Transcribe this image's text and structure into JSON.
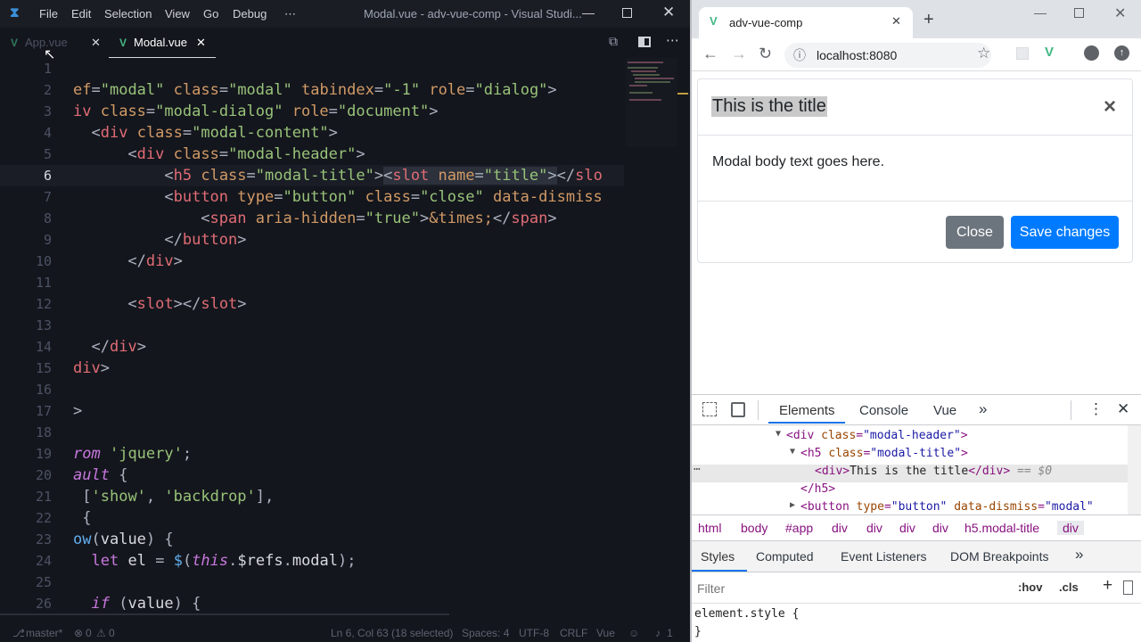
{
  "vscode": {
    "menu": [
      "File",
      "Edit",
      "Selection",
      "View",
      "Go",
      "Debug",
      "⋯"
    ],
    "window_title": "Modal.vue - adv-vue-comp - Visual Studi...",
    "tabs": [
      {
        "label": "App.vue",
        "active": false
      },
      {
        "label": "Modal.vue",
        "active": true
      }
    ],
    "lines": [
      {
        "n": "1",
        "html": ""
      },
      {
        "n": "2",
        "html": "<span class='a'>ef</span><span class='p'>=</span><span class='s'>\"modal\"</span> <span class='a'>class</span><span class='p'>=</span><span class='s'>\"modal\"</span> <span class='a'>tabindex</span><span class='p'>=</span><span class='s'>\"-1\"</span> <span class='a'>role</span><span class='p'>=</span><span class='s'>\"dialog\"</span><span class='p'>&gt;</span>"
      },
      {
        "n": "3",
        "html": "<span class='t'>iv</span> <span class='a'>class</span><span class='p'>=</span><span class='s'>\"modal-dialog\"</span> <span class='a'>role</span><span class='p'>=</span><span class='s'>\"document\"</span><span class='p'>&gt;</span>"
      },
      {
        "n": "4",
        "html": "  <span class='p'>&lt;</span><span class='t'>div</span> <span class='a'>class</span><span class='p'>=</span><span class='s'>\"modal-content\"</span><span class='p'>&gt;</span>"
      },
      {
        "n": "5",
        "html": "      <span class='p'>&lt;</span><span class='t'>div</span> <span class='a'>class</span><span class='p'>=</span><span class='s'>\"modal-header\"</span><span class='p'>&gt;</span>"
      },
      {
        "n": "6",
        "html": "          <span class='p'>&lt;</span><span class='t'>h5</span> <span class='a'>class</span><span class='p'>=</span><span class='s'>\"modal-title\"</span><span class='p'>&gt;</span><span style='background:#2c313c'><span class='p'>&lt;</span><span class='t'>slot</span> <span class='a'>name</span><span class='p'>=</span><span class='s'>\"title\"</span><span class='p'>&gt;</span></span><span class='p'>&lt;/</span><span class='t'>slo</span>"
      },
      {
        "n": "7",
        "html": "          <span class='p'>&lt;</span><span class='t'>button</span> <span class='a'>type</span><span class='p'>=</span><span class='s'>\"button\"</span> <span class='a'>class</span><span class='p'>=</span><span class='s'>\"close\"</span> <span class='a'>data-dismiss</span>"
      },
      {
        "n": "8",
        "html": "              <span class='p'>&lt;</span><span class='t'>span</span> <span class='a'>aria-hidden</span><span class='p'>=</span><span class='s'>\"true\"</span><span class='p'>&gt;</span><span class='a'>&amp;times;</span><span class='p'>&lt;/</span><span class='t'>span</span><span class='p'>&gt;</span>"
      },
      {
        "n": "9",
        "html": "          <span class='p'>&lt;/</span><span class='t'>button</span><span class='p'>&gt;</span>"
      },
      {
        "n": "10",
        "html": "      <span class='p'>&lt;/</span><span class='t'>div</span><span class='p'>&gt;</span>"
      },
      {
        "n": "11",
        "html": ""
      },
      {
        "n": "12",
        "html": "      <span class='p'>&lt;</span><span class='t'>slot</span><span class='p'>&gt;&lt;/</span><span class='t'>slot</span><span class='p'>&gt;</span>"
      },
      {
        "n": "13",
        "html": ""
      },
      {
        "n": "14",
        "html": "  <span class='p'>&lt;/</span><span class='t'>div</span><span class='p'>&gt;</span>"
      },
      {
        "n": "15",
        "html": "<span class='t'>div</span><span class='p'>&gt;</span>"
      },
      {
        "n": "16",
        "html": ""
      },
      {
        "n": "17",
        "html": "<span class='p'>&gt;</span>"
      },
      {
        "n": "18",
        "html": ""
      },
      {
        "n": "19",
        "html": "<span class='k'>rom</span> <span class='s'>'jquery'</span><span class='p'>;</span>"
      },
      {
        "n": "20",
        "html": "<span class='k'>ault</span> <span class='p'>{</span>"
      },
      {
        "n": "21",
        "html": " <span class='p'>[</span><span class='s'>'show'</span><span class='p'>,</span> <span class='s'>'backdrop'</span><span class='p'>],</span>"
      },
      {
        "n": "22",
        "html": " <span class='p'>{</span>"
      },
      {
        "n": "23",
        "html": "<span class='f'>ow</span><span class='p'>(</span><span class='w'>value</span><span class='p'>) {</span>"
      },
      {
        "n": "24",
        "html": "  <span class='k' style='font-style:normal'>let</span> <span class='w'>el</span> <span class='p'>=</span> <span class='f'>$</span><span class='p'>(</span><span class='k'>this</span><span class='p'>.</span><span class='w'>$refs</span><span class='p'>.</span><span class='w'>modal</span><span class='p'>);</span>"
      },
      {
        "n": "25",
        "html": ""
      },
      {
        "n": "26",
        "html": "  <span class='k'>if</span> <span class='p'>(</span><span class='w'>value</span><span class='p'>) {</span>"
      }
    ],
    "status": {
      "branch": "master*",
      "errors": "0",
      "warnings": "0",
      "position": "Ln 6, Col 63 (18 selected)",
      "spaces": "Spaces: 4",
      "encoding": "UTF-8",
      "eol": "CRLF",
      "language": "Vue",
      "bell": "1"
    }
  },
  "chrome": {
    "tab_title": "adv-vue-comp",
    "url": "localhost:8080",
    "modal": {
      "title": "This is the title",
      "close_x": "×",
      "body": "Modal body text goes here.",
      "close_btn": "Close",
      "save_btn": "Save changes",
      "colors": {
        "primary": "#007bff",
        "secondary": "#6c757d"
      }
    },
    "devtools": {
      "tabs": [
        "Elements",
        "Console",
        "Vue"
      ],
      "dom": [
        {
          "indent": "",
          "arrow": "▼",
          "html": "<span class='tg'>&lt;div</span> <span class='at'>class</span><span class='tg'>=</span><span class='av'>\"modal-header\"</span><span class='tg'>&gt;</span>"
        },
        {
          "indent": "  ",
          "arrow": "▼",
          "html": "<span class='tg'>&lt;h5</span> <span class='at'>class</span><span class='tg'>=</span><span class='av'>\"modal-title\"</span><span class='tg'>&gt;</span>"
        },
        {
          "indent": "    ",
          "arrow": "",
          "html": "<span class='tg'>&lt;div&gt;</span><span class='tx'>This is the title</span><span class='tg'>&lt;/div&gt;</span> <span style='color:#888;font-style:italic'>== $0</span>"
        },
        {
          "indent": "  ",
          "arrow": "",
          "html": "<span class='tg'>&lt;/h5&gt;</span>"
        },
        {
          "indent": "  ",
          "arrow": "▶",
          "html": "<span class='tg'>&lt;button</span> <span class='at'>type</span><span class='tg'>=</span><span class='av'>\"button\"</span> <span class='at'>data-dismiss</span><span class='tg'>=</span><span class='av'>\"modal\"</span>"
        }
      ],
      "breadcrumbs": [
        "html",
        "body",
        "#app",
        "div",
        "div",
        "div",
        "div",
        "h5.modal-title",
        "div"
      ],
      "style_tabs": [
        "Styles",
        "Computed",
        "Event Listeners",
        "DOM Breakpoints"
      ],
      "filter_placeholder": "Filter",
      "hov": ":hov",
      "cls": ".cls",
      "element_style": "element.style {",
      "close_brace": "}"
    }
  }
}
